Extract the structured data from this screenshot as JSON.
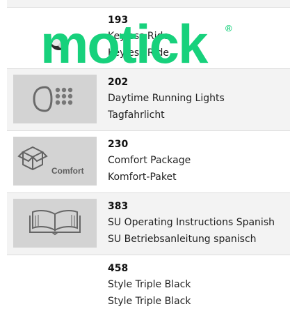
{
  "colors": {
    "watermark": "#17d17c",
    "row_shade": "#f3f3f3",
    "thumb_bg": "#d3d3d3"
  },
  "watermark": {
    "text": "motick",
    "reg_mark": "®"
  },
  "options": [
    {
      "code": "193",
      "name_en": "Keyless Ride",
      "name_de": "Keyless Ride",
      "icon": "key-fob-icon"
    },
    {
      "code": "202",
      "name_en": "Daytime Running Lights",
      "name_de": "Tagfahrlicht",
      "icon": "headlight-icon"
    },
    {
      "code": "230",
      "name_en": "Comfort Package",
      "name_de": "Komfort-Paket",
      "icon": "comfort-box-icon",
      "icon_label": "Comfort"
    },
    {
      "code": "383",
      "name_en": "SU Operating Instructions Spanish",
      "name_de": "SU Betriebsanleitung spanisch",
      "icon": "open-book-icon"
    },
    {
      "code": "458",
      "name_en": "Style Triple Black",
      "name_de": "Style Triple Black",
      "icon": ""
    }
  ]
}
